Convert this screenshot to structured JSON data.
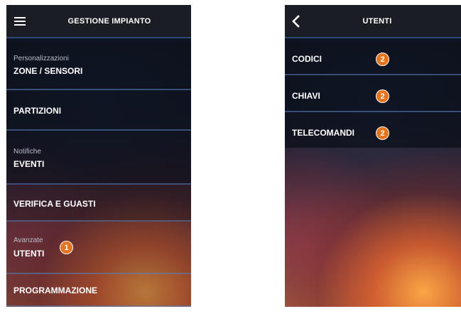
{
  "left_screen": {
    "title": "GESTIONE IMPIANTO",
    "items": [
      {
        "section": "Personalizzazioni",
        "label": "ZONE / SENSORI"
      },
      {
        "label": "PARTIZIONI"
      },
      {
        "section": "Notifiche",
        "label": "EVENTI"
      },
      {
        "label": "VERIFICA E GUASTI"
      },
      {
        "section": "Avanzate",
        "label": "UTENTI",
        "badge": "1"
      },
      {
        "label": "PROGRAMMAZIONE"
      }
    ]
  },
  "right_screen": {
    "title": "UTENTI",
    "items": [
      {
        "label": "CODICI",
        "badge": "2"
      },
      {
        "label": "CHIAVI",
        "badge": "2"
      },
      {
        "label": "TELECOMANDI",
        "badge": "2"
      }
    ]
  },
  "colors": {
    "badge": "#e6741f",
    "topbar": "#1a1d24",
    "separator": "#5a82be"
  },
  "icons": {
    "menu": "hamburger-icon",
    "back": "back-chevron-icon"
  }
}
